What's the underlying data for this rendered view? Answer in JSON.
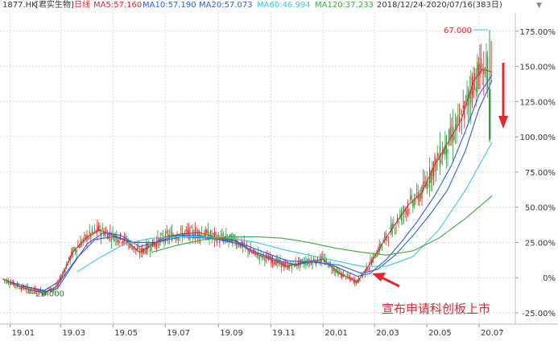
{
  "header": {
    "ticker": "1877.HK",
    "name": "[君实生物]",
    "period": "日线",
    "date_range": "2018/12/24-2020/07/16(383日)",
    "dropdown_glyph": "▼",
    "ma": [
      {
        "label": "MA5:57.160",
        "color": "#e0282e"
      },
      {
        "label": "MA10:57.190",
        "color": "#2d5fd3"
      },
      {
        "label": "MA20:57.073",
        "color": "#2d5fd3"
      },
      {
        "label": "MA60:46.994",
        "color": "#3cc6e0"
      },
      {
        "label": "MA120:37.233",
        "color": "#3aa83a"
      }
    ]
  },
  "annotation": {
    "text": "宣布申请科创板上市",
    "color": "#e0282e"
  },
  "colors": {
    "up": "#e0282e",
    "down": "#2e9e3b",
    "ma5": "#e0282e",
    "ma10": "#2d5fd3",
    "ma20": "#2d5fd3",
    "ma60": "#3cc6e0",
    "ma120": "#3aa83a",
    "grid": "#d9d9d9",
    "axis_text": "#333333"
  },
  "chart_data": {
    "type": "line",
    "title": "",
    "x_tick_labels": [
      "19.01",
      "19.03",
      "19.05",
      "19.07",
      "19.09",
      "19.11",
      "20.01",
      "20.03",
      "20.05",
      "20.07"
    ],
    "y_ticks": [
      -25,
      0,
      25,
      50,
      75,
      100,
      125,
      150,
      175
    ],
    "y_tick_labels": [
      "-25.00%",
      "0%",
      "25.00%",
      "50.00%",
      "75.00%",
      "100.00%",
      "125.00%",
      "150.00%",
      "175.00%"
    ],
    "ylim": [
      -33,
      188
    ],
    "price_labels": {
      "high": "67.000",
      "low": "20.000"
    },
    "series": [
      {
        "name": "MA5",
        "key": "ma5",
        "x": [
          "2018-12-24",
          "2019-01-15",
          "2019-02-10",
          "2019-02-25",
          "2019-03-15",
          "2019-04-01",
          "2019-04-15",
          "2019-05-01",
          "2019-05-15",
          "2019-06-01",
          "2019-06-15",
          "2019-07-01",
          "2019-07-20",
          "2019-08-10",
          "2019-09-01",
          "2019-09-20",
          "2019-10-10",
          "2019-11-01",
          "2019-11-20",
          "2019-12-10",
          "2020-01-01",
          "2020-01-20",
          "2020-02-10",
          "2020-02-25",
          "2020-03-10",
          "2020-03-25",
          "2020-04-10",
          "2020-04-25",
          "2020-05-10",
          "2020-05-25",
          "2020-06-10",
          "2020-06-25",
          "2020-07-05",
          "2020-07-16"
        ],
        "y": [
          -1,
          -7,
          -11,
          -6,
          18,
          29,
          34,
          30,
          27,
          18,
          23,
          29,
          31,
          32,
          28,
          27,
          18,
          13,
          8,
          11,
          13,
          3,
          -3,
          10,
          24,
          38,
          52,
          60,
          80,
          95,
          112,
          140,
          148,
          146
        ]
      },
      {
        "name": "MA10",
        "key": "ma10",
        "x": [
          "2019-01-01",
          "2019-02-10",
          "2019-02-25",
          "2019-03-15",
          "2019-04-01",
          "2019-04-20",
          "2019-05-10",
          "2019-06-01",
          "2019-06-20",
          "2019-07-15",
          "2019-08-10",
          "2019-09-01",
          "2019-09-25",
          "2019-10-15",
          "2019-11-10",
          "2019-12-01",
          "2019-12-20",
          "2020-01-15",
          "2020-02-10",
          "2020-02-25",
          "2020-03-15",
          "2020-04-01",
          "2020-04-20",
          "2020-05-10",
          "2020-05-30",
          "2020-06-15",
          "2020-07-01",
          "2020-07-16"
        ],
        "y": [
          -3,
          -10,
          -8,
          9,
          24,
          32,
          30,
          22,
          25,
          30,
          30,
          27,
          24,
          18,
          12,
          9,
          12,
          8,
          1,
          3,
          13,
          25,
          40,
          58,
          80,
          104,
          130,
          144
        ]
      },
      {
        "name": "MA20",
        "key": "ma20",
        "x": [
          "2019-01-15",
          "2019-02-10",
          "2019-03-01",
          "2019-03-20",
          "2019-04-10",
          "2019-05-01",
          "2019-05-25",
          "2019-06-20",
          "2019-07-20",
          "2019-08-20",
          "2019-09-20",
          "2019-10-20",
          "2019-11-20",
          "2019-12-20",
          "2020-01-20",
          "2020-02-15",
          "2020-03-05",
          "2020-03-25",
          "2020-04-15",
          "2020-05-05",
          "2020-05-25",
          "2020-06-15",
          "2020-07-01",
          "2020-07-16"
        ],
        "y": [
          -6,
          -9,
          -2,
          14,
          27,
          29,
          25,
          25,
          29,
          28,
          26,
          19,
          12,
          11,
          9,
          3,
          6,
          16,
          30,
          45,
          62,
          90,
          120,
          140
        ]
      },
      {
        "name": "MA60",
        "key": "ma60",
        "x": [
          "2019-03-20",
          "2019-04-15",
          "2019-05-15",
          "2019-06-15",
          "2019-07-15",
          "2019-08-15",
          "2019-09-15",
          "2019-10-15",
          "2019-11-15",
          "2019-12-15",
          "2020-01-15",
          "2020-02-15",
          "2020-03-15",
          "2020-04-15",
          "2020-05-15",
          "2020-06-15",
          "2020-07-16"
        ],
        "y": [
          4,
          14,
          24,
          28,
          29,
          29,
          28,
          25,
          20,
          16,
          12,
          8,
          8,
          15,
          34,
          62,
          96
        ]
      },
      {
        "name": "MA120",
        "key": "ma120",
        "x": [
          "2019-06-15",
          "2019-07-15",
          "2019-08-15",
          "2019-09-15",
          "2019-10-15",
          "2019-11-15",
          "2019-12-15",
          "2020-01-15",
          "2020-02-15",
          "2020-03-15",
          "2020-04-15",
          "2020-05-15",
          "2020-06-15",
          "2020-07-16"
        ],
        "y": [
          18,
          23,
          27,
          29,
          29,
          28,
          25,
          21,
          18,
          16,
          19,
          28,
          42,
          58
        ]
      }
    ]
  }
}
